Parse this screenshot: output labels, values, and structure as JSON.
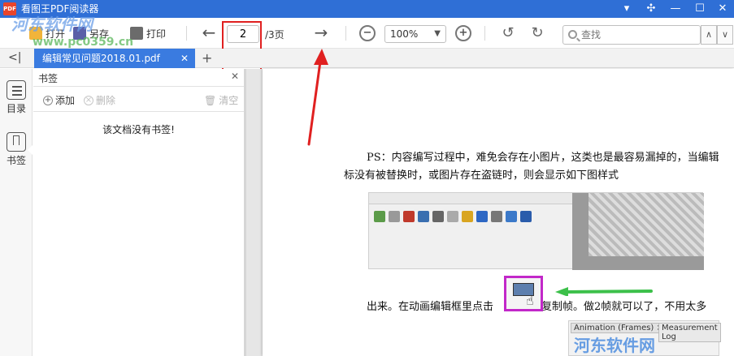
{
  "window": {
    "title": "看图王PDF阅读器",
    "logo_text": "PDF",
    "title_color": "#2f6fd6"
  },
  "toolbar": {
    "open_label": "打开",
    "save_as_label": "另存",
    "print_label": "打印",
    "current_page": "2",
    "total_pages": "/3页",
    "zoom_level": "100%",
    "search_placeholder": "查找"
  },
  "tabs": [
    {
      "label": "编辑常见问题2018.01.pdf",
      "active": true
    }
  ],
  "sidebar_rail": {
    "items": [
      {
        "label": "目录",
        "icon": "list-icon"
      },
      {
        "label": "书签",
        "icon": "bookmark-icon",
        "active": true
      }
    ]
  },
  "bookmark_panel": {
    "title": "书签",
    "add_label": "添加",
    "delete_label": "删除",
    "clear_label": "清空",
    "empty_message": "该文档没有书签!"
  },
  "document": {
    "para1_line1": "PS：内容编写过程中，难免会存在小图片，这类也是最容易漏掉的，当编辑",
    "para1_line2": "标没有被替换时，或图片存在盗链时，则会显示如下图样式",
    "para2_before": "出来。在动画编辑框里点击",
    "para2_after": "，复制帧。做2帧就可以了，不用太多",
    "shot_tab_a": "Animation (Frames) ×",
    "shot_tab_b": "Measurement Log"
  },
  "watermarks": {
    "top": "河东软件网",
    "top_url": "www.pc0359.cn",
    "bottom": "河东软件网"
  },
  "colors": {
    "tab_active": "#3a7be0",
    "highlight_red": "#e02020",
    "highlight_magenta": "#c228c9",
    "arrow_green": "#3cc04a"
  }
}
